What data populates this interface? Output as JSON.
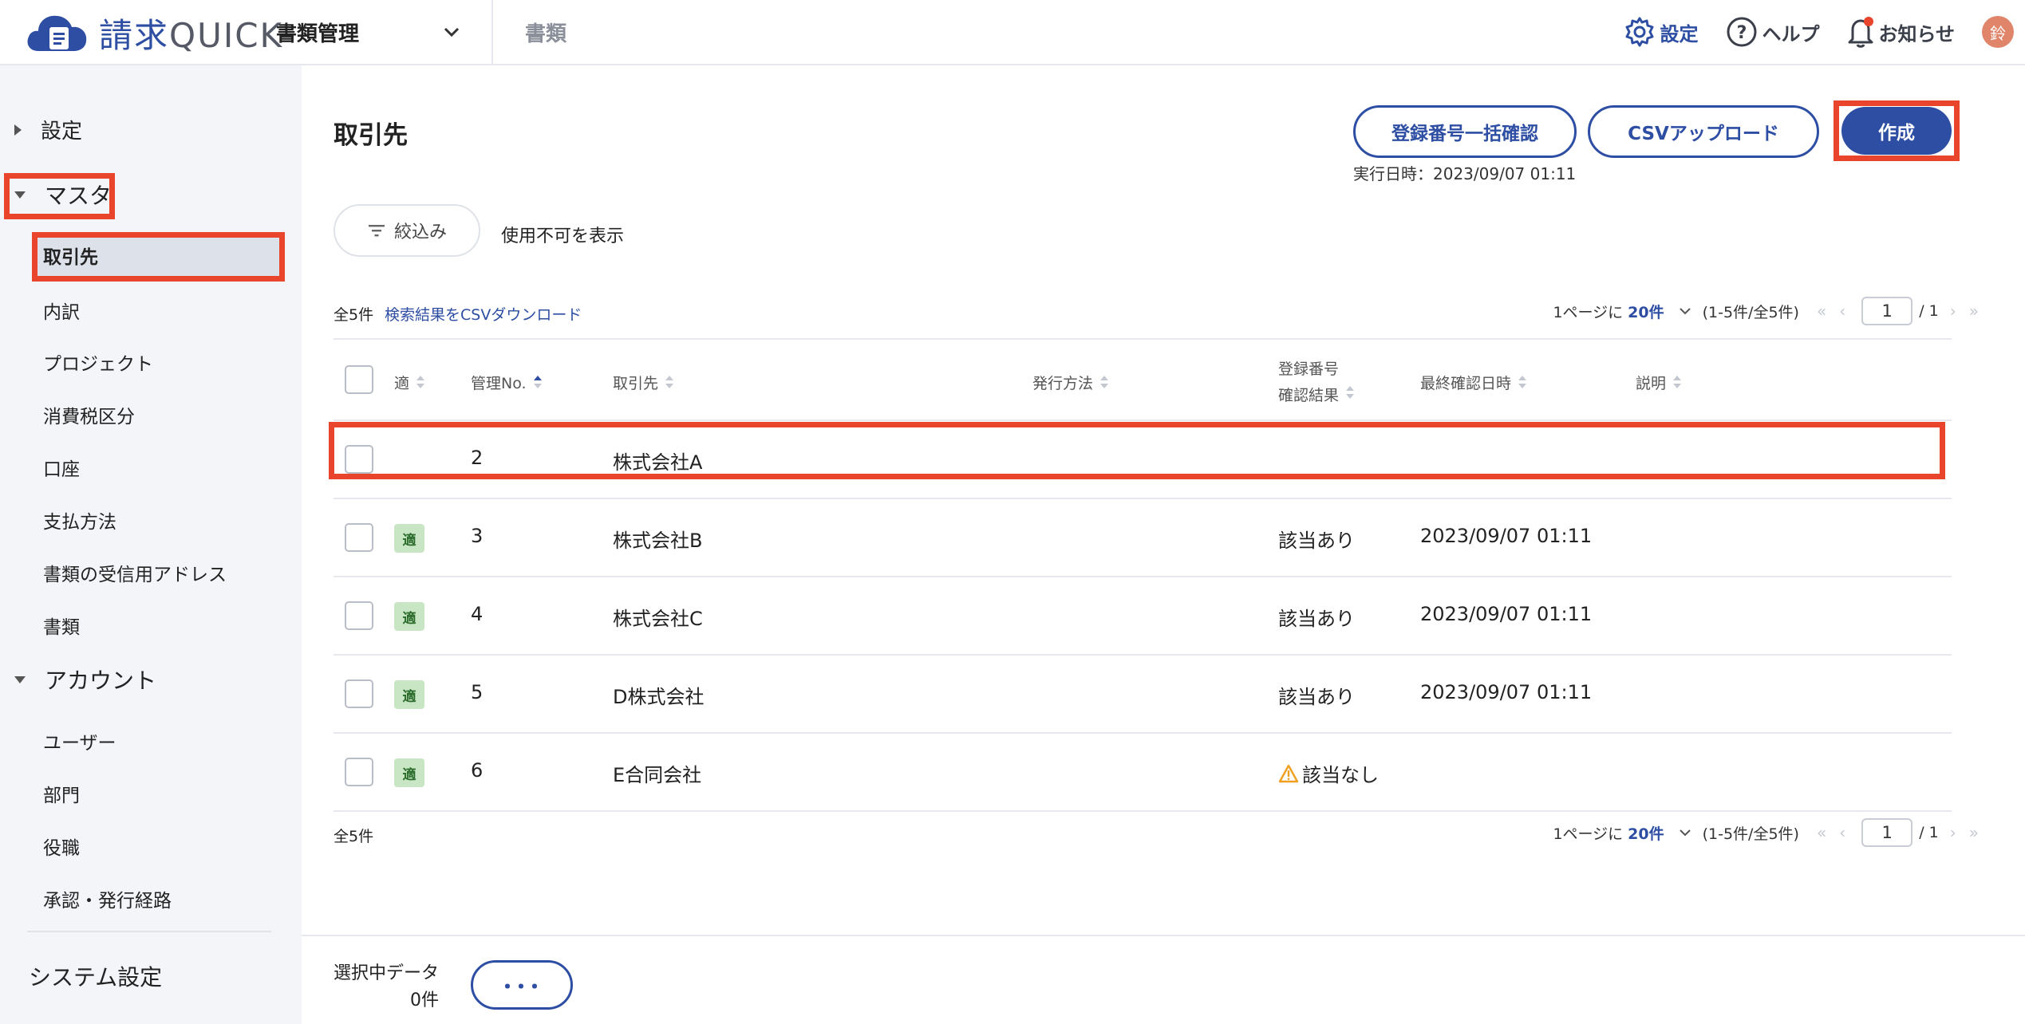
{
  "header": {
    "logo_kanji": "請求",
    "logo_latin": "QUICK",
    "app_select_label": "書類管理",
    "breadcrumb": "書類",
    "settings_label": "設定",
    "help_label": "ヘルプ",
    "notice_label": "お知らせ",
    "avatar_initial": "鈴"
  },
  "sidebar": {
    "settings": "設定",
    "master": "マスタ",
    "master_items": [
      "取引先",
      "内訳",
      "プロジェクト",
      "消費税区分",
      "口座",
      "支払方法",
      "書類の受信用アドレス",
      "書類"
    ],
    "account": "アカウント",
    "account_items": [
      "ユーザー",
      "部門",
      "役職",
      "承認・発行経路"
    ],
    "system_settings": "システム設定"
  },
  "main": {
    "title": "取引先",
    "bulk_check_button": "登録番号一括確認",
    "csv_upload_button": "CSVアップロード",
    "create_button": "作成",
    "exec_time": "実行日時：2023/09/07 01:11",
    "filter_button": "絞込み",
    "show_disabled": "使用不可を表示",
    "total_count": "全5件",
    "csv_download_link": "検索結果をCSVダウンロード",
    "pager": {
      "per_page_prefix": "1ページに",
      "per_page_value": "20件",
      "range": "(1-5件/全5件)",
      "current_page": "1",
      "total_pages": "/ 1"
    }
  },
  "table": {
    "headers": {
      "qualified": "適",
      "no": "管理No.",
      "partner": "取引先",
      "method": "発行方法",
      "reg_line1": "登録番号",
      "reg_line2": "確認結果",
      "last_checked": "最終確認日時",
      "description": "説明"
    },
    "badge_label": "適",
    "rows": [
      {
        "no": "2",
        "partner": "株式会社A",
        "reg_result": "",
        "last_checked": ""
      },
      {
        "no": "3",
        "partner": "株式会社B",
        "reg_result": "該当あり",
        "last_checked": "2023/09/07 01:11"
      },
      {
        "no": "4",
        "partner": "株式会社C",
        "reg_result": "該当あり",
        "last_checked": "2023/09/07 01:11"
      },
      {
        "no": "5",
        "partner": "D株式会社",
        "reg_result": "該当あり",
        "last_checked": "2023/09/07 01:11"
      },
      {
        "no": "6",
        "partner": "E合同会社",
        "reg_result": "該当なし",
        "last_checked": ""
      }
    ]
  },
  "bottom_bar": {
    "selected_label": "選択中データ",
    "selected_count": "0件",
    "more_button": "･･･"
  },
  "colors": {
    "accent": "#2d4ea3",
    "highlight": "#e8452c",
    "badge_bg": "#c9e6c4",
    "warning": "#f0a020"
  }
}
